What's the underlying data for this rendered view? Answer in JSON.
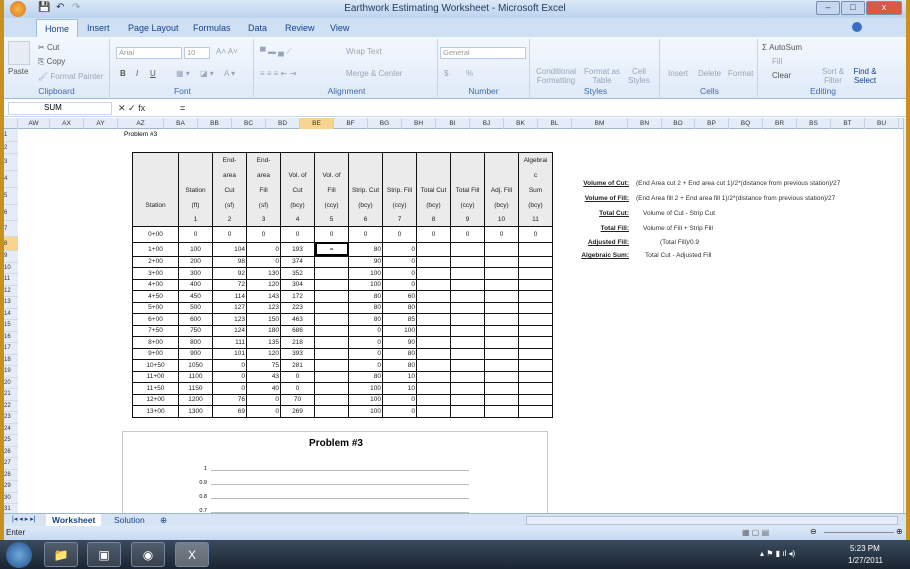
{
  "window": {
    "title": "Earthwork Estimating Worksheet - Microsoft Excel",
    "controls": [
      "–",
      "□",
      "x"
    ]
  },
  "ribbon_tabs": [
    "Home",
    "Insert",
    "Page Layout",
    "Formulas",
    "Data",
    "Review",
    "View"
  ],
  "ribbon": {
    "clipboard": {
      "label": "Clipboard",
      "paste": "Paste",
      "cut": "Cut",
      "copy": "Copy",
      "format_painter": "Format Painter"
    },
    "font": {
      "label": "Font",
      "font_name": "Arial",
      "font_size": "10",
      "bold": "B",
      "italic": "I",
      "underline": "U"
    },
    "alignment": {
      "label": "Alignment",
      "wrap_text": "Wrap Text",
      "merge_center": "Merge & Center"
    },
    "number": {
      "label": "Number",
      "format": "General",
      "currency": "$",
      "percent": "%"
    },
    "styles": {
      "label": "Styles",
      "conditional": "Conditional Formatting",
      "format_table": "Format as Table",
      "cell_styles": "Cell Styles"
    },
    "cells": {
      "label": "Cells",
      "insert": "Insert",
      "delete": "Delete",
      "format": "Format"
    },
    "editing": {
      "label": "Editing",
      "autosum": "Σ AutoSum",
      "fill": "Fill",
      "clear": "Clear",
      "sort": "Sort & Filter",
      "find": "Find & Select"
    }
  },
  "formula_bar": {
    "name_box": "SUM",
    "formula": "="
  },
  "columns": [
    "AW",
    "AX",
    "AY",
    "AZ",
    "BA",
    "BB",
    "BC",
    "BD",
    "BE",
    "BF",
    "BG",
    "BH",
    "BI",
    "BJ",
    "BK",
    "BL",
    "BM",
    "BN",
    "BO",
    "BP",
    "BQ",
    "BR",
    "BS",
    "BT",
    "BU"
  ],
  "selected_column": "BE",
  "selected_row": 8,
  "problem_label": "Problem #3",
  "table": {
    "headers": [
      [
        "Station"
      ],
      [
        "Station",
        "(ft)"
      ],
      [
        "End-",
        "area",
        "Cut",
        "(sf)"
      ],
      [
        "End-",
        "area",
        "Fill",
        "(sf)"
      ],
      [
        "Vol. of",
        "Cut",
        "(bcy)"
      ],
      [
        "Vol. of",
        "Fill",
        "(ccy)"
      ],
      [
        "Strip. Cut",
        "(bcy)"
      ],
      [
        "Strip. Fill",
        "(ccy)"
      ],
      [
        "Total Cut",
        "(bcy)"
      ],
      [
        "Total Fill",
        "(ccy)"
      ],
      [
        "Adj. Fill",
        "(bcy)"
      ],
      [
        "Algebrai",
        "c",
        "Sum",
        "(bcy)"
      ]
    ],
    "numbers": [
      "",
      "1",
      "2",
      "3",
      "4",
      "5",
      "6",
      "7",
      "8",
      "9",
      "10",
      "11"
    ],
    "rows": [
      [
        "0+00",
        "0",
        "0",
        "0",
        "0",
        "0",
        "0",
        "0",
        "0",
        "0",
        "0",
        "0"
      ],
      [
        "1+00",
        "100",
        "104",
        "0",
        "193",
        "=",
        "80",
        "0",
        "",
        "",
        "",
        ""
      ],
      [
        "2+00",
        "200",
        "98",
        "0",
        "374",
        "",
        "90",
        "0",
        "",
        "",
        "",
        ""
      ],
      [
        "3+00",
        "300",
        "92",
        "130",
        "352",
        "",
        "100",
        "0",
        "",
        "",
        "",
        ""
      ],
      [
        "4+00",
        "400",
        "72",
        "120",
        "304",
        "",
        "100",
        "0",
        "",
        "",
        "",
        ""
      ],
      [
        "4+50",
        "450",
        "114",
        "143",
        "172",
        "",
        "80",
        "60",
        "",
        "",
        "",
        ""
      ],
      [
        "5+00",
        "500",
        "127",
        "123",
        "223",
        "",
        "80",
        "80",
        "",
        "",
        "",
        ""
      ],
      [
        "6+00",
        "600",
        "123",
        "150",
        "463",
        "",
        "80",
        "85",
        "",
        "",
        "",
        ""
      ],
      [
        "7+50",
        "750",
        "124",
        "180",
        "686",
        "",
        "0",
        "100",
        "",
        "",
        "",
        ""
      ],
      [
        "8+00",
        "800",
        "111",
        "135",
        "218",
        "",
        "0",
        "90",
        "",
        "",
        "",
        ""
      ],
      [
        "9+00",
        "900",
        "101",
        "120",
        "393",
        "",
        "0",
        "80",
        "",
        "",
        "",
        ""
      ],
      [
        "10+50",
        "1050",
        "0",
        "75",
        "281",
        "",
        "0",
        "80",
        "",
        "",
        "",
        ""
      ],
      [
        "11+00",
        "1100",
        "0",
        "43",
        "0",
        "",
        "80",
        "10",
        "",
        "",
        "",
        ""
      ],
      [
        "11+50",
        "1150",
        "0",
        "40",
        "0",
        "",
        "100",
        "10",
        "",
        "",
        "",
        ""
      ],
      [
        "12+00",
        "1200",
        "76",
        "0",
        "70",
        "",
        "100",
        "0",
        "",
        "",
        "",
        ""
      ],
      [
        "13+00",
        "1300",
        "69",
        "0",
        "269",
        "",
        "100",
        "0",
        "",
        "",
        "",
        ""
      ]
    ]
  },
  "notes": [
    {
      "label": "Volume of Cut:",
      "text": "(End Area cut 2 + End area cut 1)/2*(distance from previous station)/27"
    },
    {
      "label": "Volume of Fill:",
      "text": "(End Area fill 2 + End area fill 1)/2*(distance from previous station)/27"
    },
    {
      "label": "Total Cut:",
      "text": "Volume of Cut - Strip Cut"
    },
    {
      "label": "Total Fill:",
      "text": "Volume of Fill + Strip Fill"
    },
    {
      "label": "Adjusted Fill:",
      "text": "(Total Fill)/0.9"
    },
    {
      "label": "Algebraic Sum:",
      "text": "Total Cut - Adjusted Fill"
    }
  ],
  "chart": {
    "title": "Problem #3",
    "y_ticks": [
      "1",
      "0.9",
      "0.8",
      "0.7"
    ]
  },
  "sheet_tabs": [
    "Worksheet",
    "Solution"
  ],
  "status": {
    "mode": "Enter"
  },
  "taskbar": {
    "time": "5:23 PM",
    "date": "1/27/2011"
  }
}
